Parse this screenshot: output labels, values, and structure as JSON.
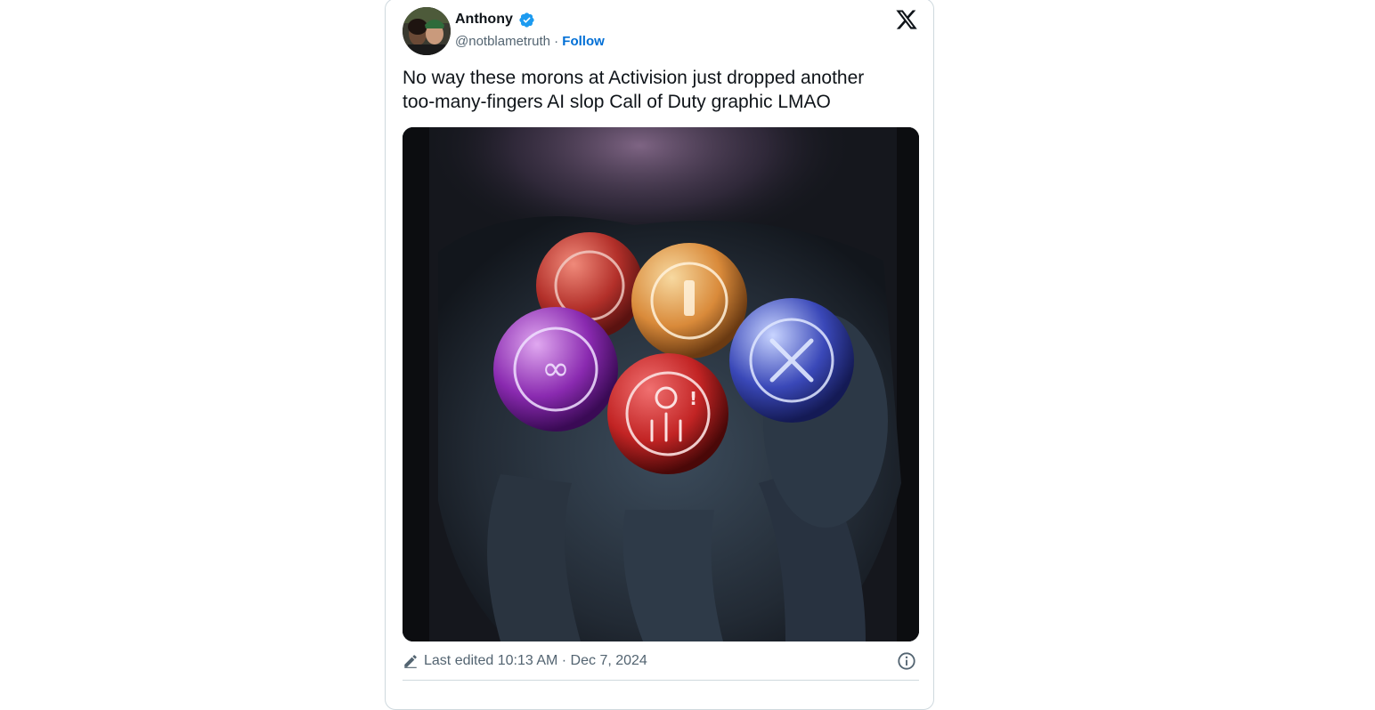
{
  "tweet": {
    "author": {
      "name": "Anthony",
      "handle": "@notblametruth",
      "separator": "·",
      "follow_label": "Follow",
      "verified": true
    },
    "text_lines": [
      "No way these morons at Activision just dropped another",
      "too-many-fingers AI slop Call of Duty graphic LMAO"
    ],
    "footer": {
      "edited_label": "Last edited 10:13 AM · Dec 7, 2024"
    }
  },
  "icons": {
    "platform": "x-logo-icon",
    "verified": "verified-badge-icon",
    "edited": "pencil-icon",
    "info": "info-icon"
  },
  "colors": {
    "text_primary": "#0f1419",
    "text_secondary": "#536471",
    "link": "#006fd6",
    "verified": "#1d9bf0",
    "border": "#cfd9de"
  }
}
